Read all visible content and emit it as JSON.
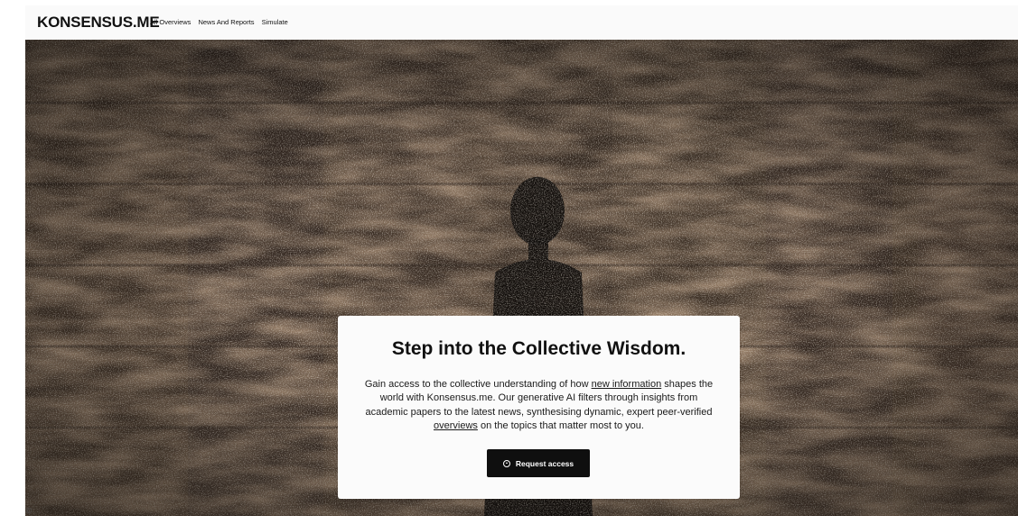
{
  "nav": {
    "logo": "KONSENSUS.ME",
    "links": [
      "All Overviews",
      "News And Reports",
      "Simulate"
    ]
  },
  "hero": {
    "background_image": "noisy-bookshelves-silhouette",
    "title": "Step into the Collective Wisdom.",
    "body": {
      "part1": "Gain access to the collective understanding of how ",
      "link1": "new information",
      "part2": " shapes the world with Konsensus.me. Our generative AI filters through insights from academic papers to the latest news, synthesising dynamic, expert peer-verified ",
      "link2": "overviews",
      "part3": " on the topics that matter most to you."
    },
    "cta_label": "Request access",
    "cta_icon": "arrow-up-circle-icon"
  },
  "footer": {
    "copyright": "©"
  },
  "colors": {
    "nav_bg": "#fafafa",
    "card_bg": "#fbfbfb",
    "button_bg": "#0f0f0f",
    "hero_base": "#3a2c22"
  }
}
